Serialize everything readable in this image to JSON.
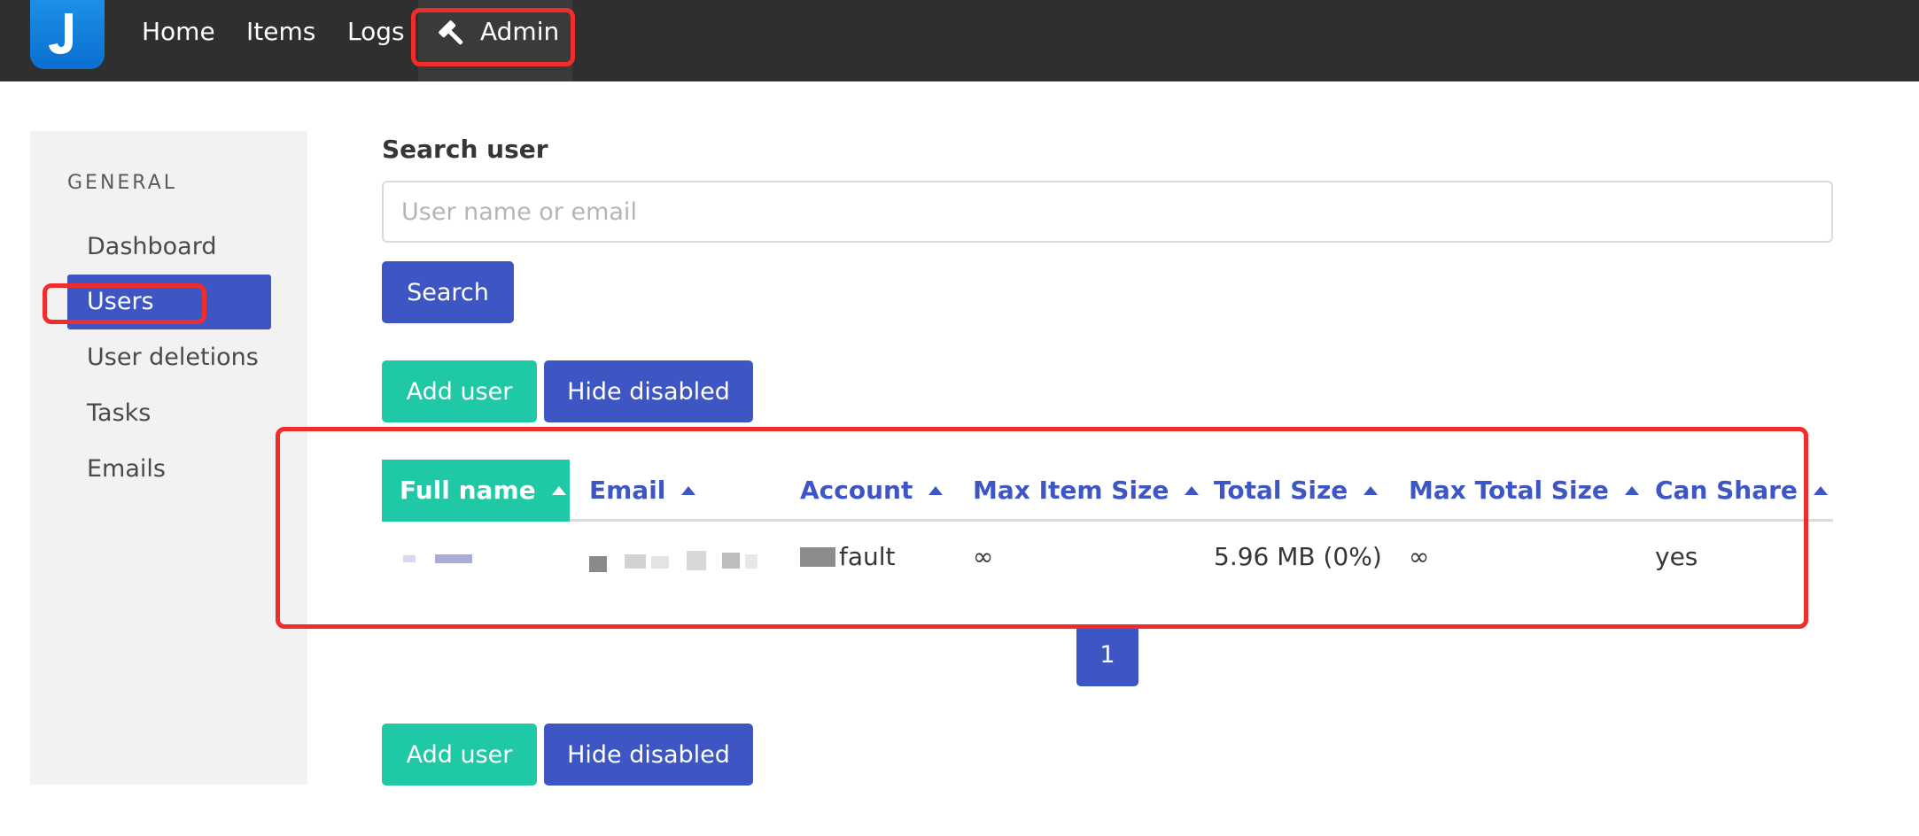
{
  "nav": {
    "links": [
      "Home",
      "Items",
      "Logs"
    ],
    "admin_label": "Admin",
    "admin_icon": "hammer-icon",
    "logo_icon": "jirafeau-logo-icon"
  },
  "sidebar": {
    "section_label": "GENERAL",
    "items": [
      {
        "label": "Dashboard",
        "active": false
      },
      {
        "label": "Users",
        "active": true
      },
      {
        "label": "User deletions",
        "active": false
      },
      {
        "label": "Tasks",
        "active": false
      },
      {
        "label": "Emails",
        "active": false
      }
    ]
  },
  "search": {
    "label": "Search user",
    "placeholder": "User name or email",
    "value": "",
    "button_label": "Search"
  },
  "actions": {
    "add_user": "Add user",
    "hide_disabled": "Hide disabled"
  },
  "table": {
    "columns": [
      "Full name",
      "Email",
      "Account",
      "Max Item Size",
      "Total Size",
      "Max Total Size",
      "Can Share"
    ],
    "sorted_column": "Full name",
    "sort_icon": "sort-up-icon",
    "rows": [
      {
        "full_name": "",
        "email": "",
        "account": "fault",
        "max_item_size": "∞",
        "total_size": "5.96 MB (0%)",
        "max_total_size": "∞",
        "can_share": "yes"
      }
    ]
  },
  "pagination": {
    "current_page": "1"
  },
  "colors": {
    "primary": "#3e56c4",
    "success": "#1fc9a6",
    "navbar": "#2f2f2f",
    "annotation": "#f22b2b"
  }
}
